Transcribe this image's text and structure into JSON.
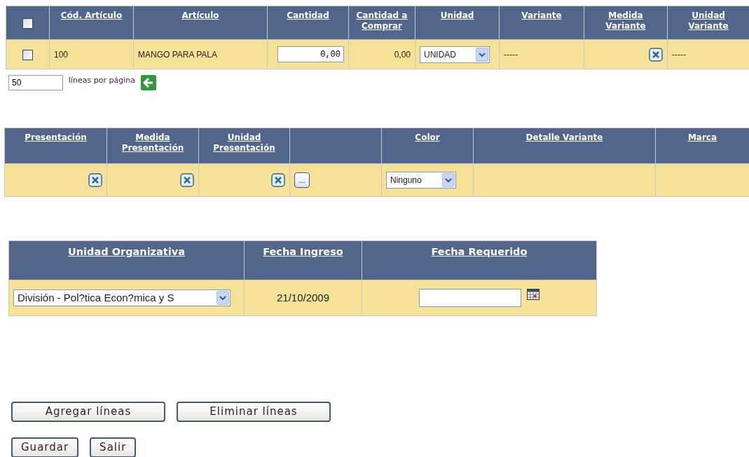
{
  "items_table": {
    "columns": [
      {
        "kind": "checkbox",
        "checked": false
      },
      {
        "kind": "link",
        "label": "Cód. Artículo"
      },
      {
        "kind": "link",
        "label": "Artículo"
      },
      {
        "kind": "link",
        "label": "Cantidad"
      },
      {
        "kind": "link",
        "label": "Cantidad a Comprar"
      },
      {
        "kind": "link",
        "label": "Unidad"
      },
      {
        "kind": "link",
        "label": "Variante"
      },
      {
        "kind": "link",
        "label": "Medida Variante"
      },
      {
        "kind": "link",
        "label": "Unidad Variante"
      }
    ],
    "rows": [
      {
        "cells": [
          {
            "kind": "checkbox",
            "checked": false
          },
          {
            "kind": "text",
            "text": "100"
          },
          {
            "kind": "text",
            "text": "MANGO PARA PALA"
          },
          {
            "kind": "input",
            "value": "0,00"
          },
          {
            "kind": "number",
            "text": "0,00"
          },
          {
            "kind": "select",
            "value": "UNIDAD"
          },
          {
            "kind": "text",
            "text": "-----"
          },
          {
            "kind": "clear"
          },
          {
            "kind": "text",
            "text": "-----"
          }
        ]
      }
    ]
  },
  "pagination": {
    "lines_per_page": "50",
    "label": "líneas por página"
  },
  "details_table": {
    "columns": [
      {
        "kind": "link",
        "label": "Presentación"
      },
      {
        "kind": "link",
        "label": "Medida Presentación"
      },
      {
        "kind": "link",
        "label": "Unidad Presentación"
      },
      {
        "kind": "blank"
      },
      {
        "kind": "link",
        "label": "Color"
      },
      {
        "kind": "link",
        "label": "Detalle Variante"
      },
      {
        "kind": "link",
        "label": "Marca"
      }
    ],
    "rows": [
      {
        "cells": [
          {
            "kind": "clear"
          },
          {
            "kind": "clear"
          },
          {
            "kind": "clear"
          },
          {
            "kind": "ellipsis",
            "label": "..."
          },
          {
            "kind": "select",
            "value": "Ninguno"
          },
          {
            "kind": "empty"
          },
          {
            "kind": "empty"
          }
        ]
      }
    ]
  },
  "org_table": {
    "columns": [
      {
        "kind": "link",
        "label": "Unidad Organizativa"
      },
      {
        "kind": "link",
        "label": "Fecha Ingreso"
      },
      {
        "kind": "link",
        "label": "Fecha Requerido"
      }
    ],
    "rows": [
      {
        "cells": [
          {
            "kind": "select",
            "value": "División - Pol?tica Econ?mica y S"
          },
          {
            "kind": "center",
            "text": "21/10/2009"
          },
          {
            "kind": "date_input"
          }
        ]
      }
    ]
  },
  "buttons": [
    [
      "Agregar líneas",
      "Eliminar líneas"
    ],
    [
      "Guardar",
      "Salir"
    ]
  ]
}
